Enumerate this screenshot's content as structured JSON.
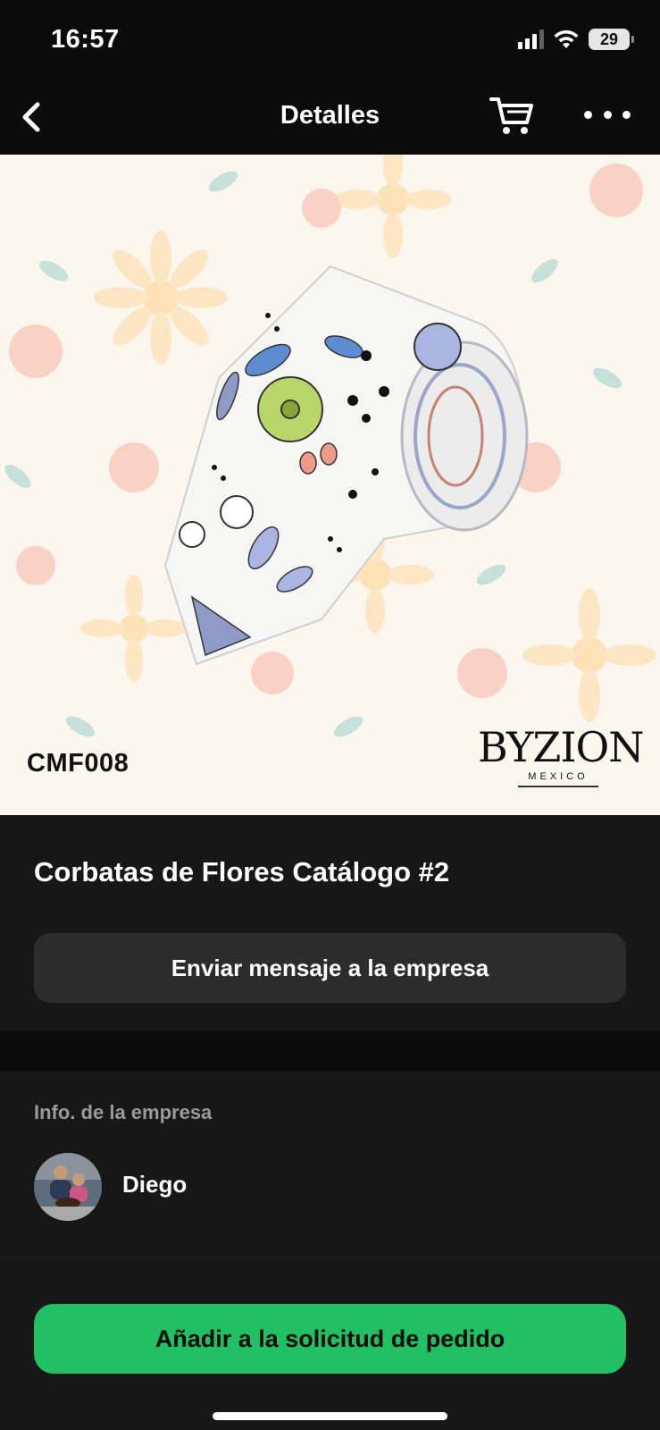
{
  "status_bar": {
    "time": "16:57",
    "battery": "29",
    "icons": [
      "signal-icon",
      "wifi-icon",
      "battery-icon"
    ]
  },
  "nav": {
    "title": "Detalles",
    "icons": [
      "back-chevron-icon",
      "cart-icon",
      "more-dots-icon"
    ]
  },
  "product": {
    "sku": "CMF008",
    "brand_name": "BYZION",
    "brand_sub": "MEXICO",
    "title": "Corbatas de Flores Catálogo #2",
    "message_button_label": "Enviar mensaje a la empresa"
  },
  "company": {
    "section_title": "Info. de la empresa",
    "name": "Diego"
  },
  "actions": {
    "order_button_label": "Añadir a la solicitud de pedido"
  },
  "colors": {
    "accent_green": "#21c063",
    "background": "#0b0b0b",
    "panel": "#171717",
    "secondary_button": "#2c2c2c"
  }
}
